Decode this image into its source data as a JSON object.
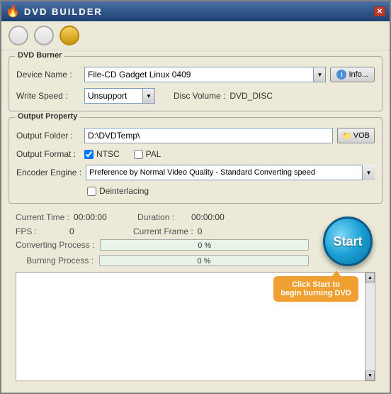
{
  "window": {
    "title": "DVD BUILDER",
    "icon": "🔥",
    "close_label": "✕"
  },
  "toolbar": {
    "btn1_label": "",
    "btn2_label": "",
    "btn3_label": ""
  },
  "dvd_burner": {
    "group_title": "DVD Burner",
    "device_label": "Device Name :",
    "device_value": "File-CD Gadget  Linux   0409",
    "info_label": "Info...",
    "write_speed_label": "Write Speed :",
    "write_speed_value": "Unsupport",
    "disc_volume_label": "Disc Volume :",
    "disc_volume_value": "DVD_DISC"
  },
  "output_property": {
    "group_title": "Output Property",
    "output_folder_label": "Output Folder :",
    "output_folder_value": "D:\\DVDTemp\\",
    "vob_label": "VOB",
    "output_format_label": "Output Format :",
    "ntsc_label": "NTSC",
    "pal_label": "PAL",
    "ntsc_checked": true,
    "pal_checked": false,
    "encoder_label": "Encoder Engine :",
    "encoder_value": "Preference by Normal Video Quality - Standard Converting speed",
    "deinterlacing_label": "Deinterlacing"
  },
  "stats": {
    "current_time_label": "Current Time :",
    "current_time_value": "00:00:00",
    "duration_label": "Duration :",
    "duration_value": "00:00:00",
    "fps_label": "FPS :",
    "fps_value": "0",
    "current_frame_label": "Current Frame :",
    "current_frame_value": "0"
  },
  "progress": {
    "converting_label": "Converting Process :",
    "converting_pct": "0 %",
    "converting_fill": 0,
    "burning_label": "Burning Process :",
    "burning_pct": "0 %",
    "burning_fill": 0
  },
  "start_button": {
    "label": "Start"
  },
  "tooltip": {
    "text": "Click Start to begin burning DVD"
  }
}
